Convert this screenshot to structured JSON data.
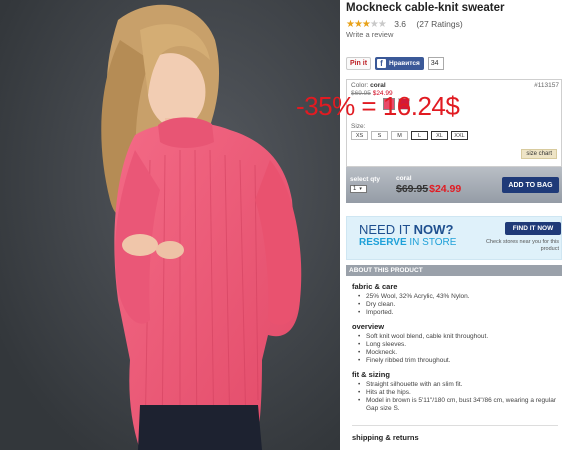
{
  "product": {
    "title": "Mockneck cable-knit sweater",
    "rating_value": "3.6",
    "rating_count": "(27 Ratings)",
    "write_review": "Write a review"
  },
  "share": {
    "pinterest_label": "Pin it",
    "facebook_label": "Нравится",
    "facebook_count": "34"
  },
  "options": {
    "color_label": "Color:",
    "color_value": "coral",
    "sku": "#113157",
    "price_old": "$69.95",
    "price_new": "$24.99",
    "size_label": "Size:",
    "sizes": [
      "XS",
      "S",
      "M",
      "L",
      "XL",
      "XXL"
    ],
    "size_chart": "size chart"
  },
  "overlay": {
    "discount_text": "-35% = 16.24$",
    "color": "#e11b22"
  },
  "cart": {
    "qty_label": "select qty",
    "qty_value": "1",
    "color": "coral",
    "price_old": "$69.95",
    "price_new": "$24.99",
    "add_button": "ADD TO BAG"
  },
  "promo": {
    "line1_a": "NEED IT ",
    "line1_b": "NOW?",
    "line2_a": "RESERVE",
    "line2_b": " IN STORE",
    "button": "FIND IT NOW",
    "note": "Check stores near you for this product"
  },
  "about": {
    "header": "ABOUT THIS PRODUCT",
    "sections": [
      {
        "title": "fabric & care",
        "items": [
          "25% Wool, 32% Acrylic, 43% Nylon.",
          "Dry clean.",
          "Imported."
        ]
      },
      {
        "title": "overview",
        "items": [
          "Soft knit wool blend, cable knit throughout.",
          "Long sleeves.",
          "Mockneck.",
          "Finely ribbed trim throughout."
        ]
      },
      {
        "title": "fit & sizing",
        "items": [
          "Straight silhouette with an slim fit.",
          "Hits at the hips.",
          "Model in brown is 5'11\"/180 cm, bust 34\"/86 cm, wearing a regular Gap size S."
        ]
      }
    ],
    "shipping": "shipping & returns"
  },
  "colors": {
    "accent_red": "#e11b22",
    "button_navy": "#1f3a78",
    "sweater": "#ef5b78"
  }
}
